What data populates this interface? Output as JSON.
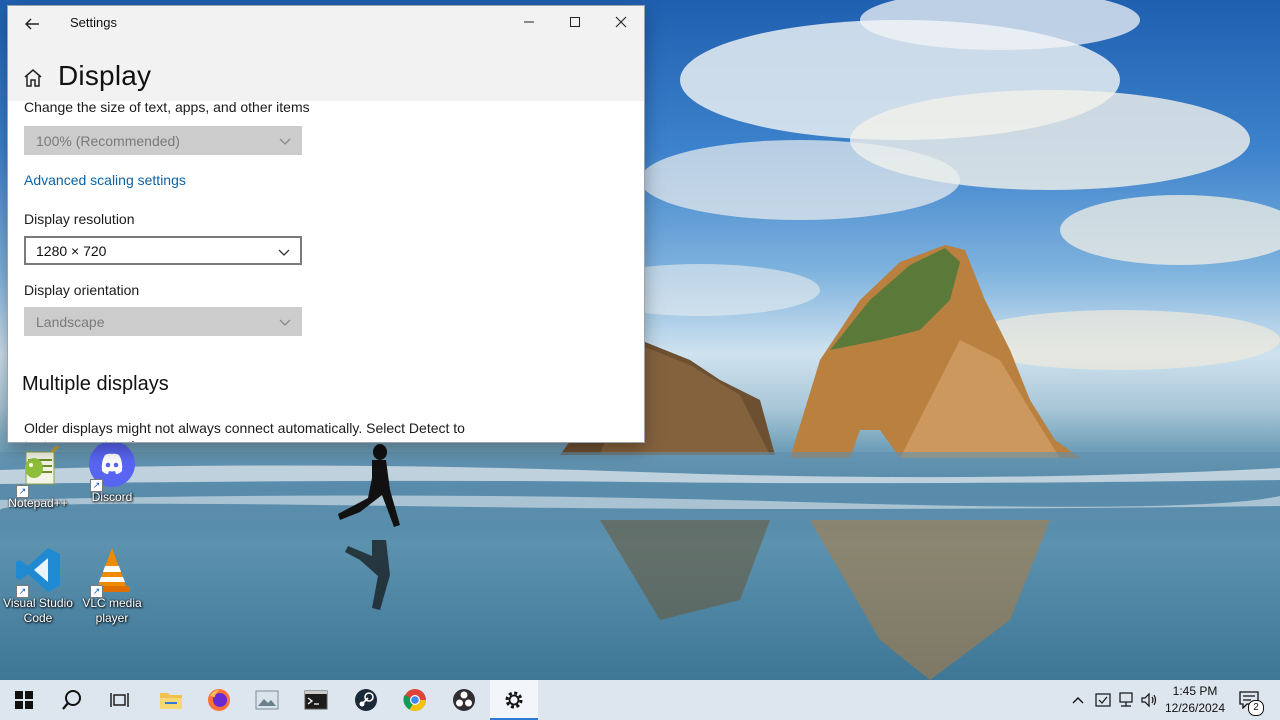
{
  "window": {
    "app_title": "Settings",
    "page_title": "Display",
    "minimize_icon": "minimize-icon",
    "maximize_icon": "maximize-icon",
    "close_icon": "close-icon"
  },
  "display": {
    "scale_label": "Change the size of text, apps, and other items",
    "scale_value": "100% (Recommended)",
    "advanced_link": "Advanced scaling settings",
    "resolution_label": "Display resolution",
    "resolution_value": "1280 × 720",
    "orientation_label": "Display orientation",
    "orientation_value": "Landscape",
    "multiple_title": "Multiple displays",
    "multiple_text": "Older displays might not always connect automatically. Select Detect to try to connect to them."
  },
  "desktop_icons": [
    {
      "label": "Notepad++",
      "icon": "notepad-plus-plus-icon"
    },
    {
      "label": "Discord",
      "icon": "discord-icon"
    },
    {
      "label": "Visual Studio Code",
      "icon": "vscode-icon"
    },
    {
      "label": "VLC media player",
      "icon": "vlc-icon"
    }
  ],
  "taskbar": {
    "apps": [
      "start-icon",
      "search-icon",
      "task-view-icon",
      "file-explorer-icon",
      "firefox-icon",
      "photos-icon",
      "terminal-icon",
      "steam-icon",
      "chrome-icon",
      "obs-icon",
      "settings-icon"
    ],
    "time": "1:45 PM",
    "date": "12/26/2024",
    "notification_count": "2"
  },
  "colors": {
    "link": "#0a62a8",
    "accent": "#2f7bd1",
    "titlebar": "#f2f2f2",
    "taskbar": "#dde6ee"
  }
}
